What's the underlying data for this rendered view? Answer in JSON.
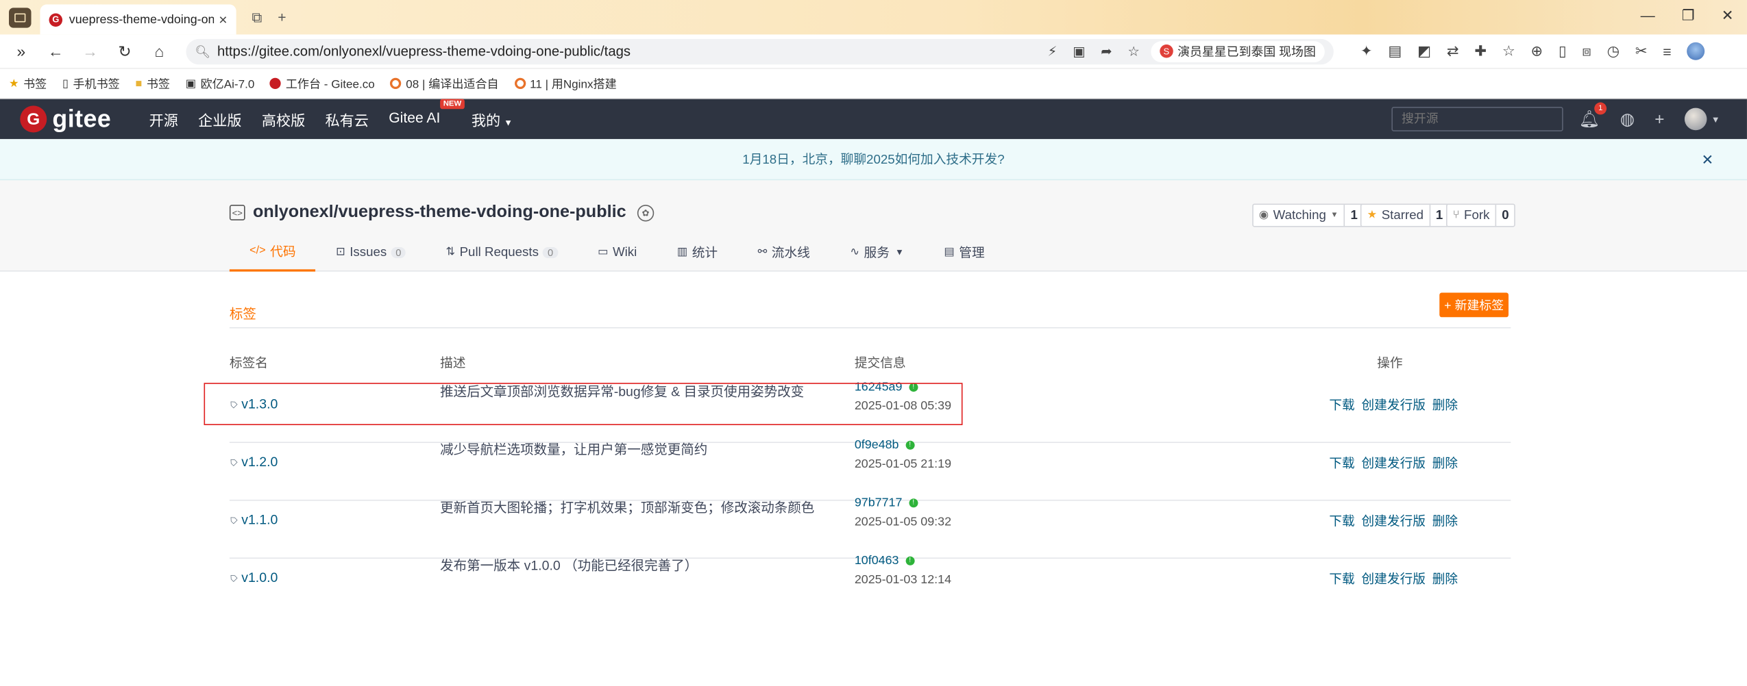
{
  "browser": {
    "tab_title": "vuepress-theme-vdoing-one-",
    "tab_close": "×",
    "new_tab": "+",
    "window_controls": [
      "—",
      "❐",
      "✕"
    ],
    "url": "https://gitee.com/onlyonexl/vuepress-theme-vdoing-one-public/tags",
    "hot_search": "演员星星已到泰国 现场图",
    "bookmarks": [
      {
        "label": "书签",
        "icon": "star-icon"
      },
      {
        "label": "手机书签",
        "icon": "phone-icon"
      },
      {
        "label": "书签",
        "icon": "folder-icon"
      },
      {
        "label": "欧亿Ai-7.0",
        "icon": "app-icon"
      },
      {
        "label": "工作台 - Gitee.co",
        "icon": "gitee-icon"
      },
      {
        "label": "08 | 编译出适合自",
        "icon": "orange-icon"
      },
      {
        "label": "11 | 用Nginx搭建",
        "icon": "orange-icon"
      }
    ]
  },
  "header": {
    "logo_text": "gitee",
    "nav": [
      "开源",
      "企业版",
      "高校版",
      "私有云",
      "Gitee AI",
      "我的"
    ],
    "new_badge": "NEW",
    "search_placeholder": "搜开源",
    "notification_count": "1"
  },
  "announcement": {
    "text": "1月18日，北京，聊聊2025如何加入技术开发?",
    "close": "✕"
  },
  "project": {
    "name": "onlyonexl/vuepress-theme-vdoing-one-public",
    "watch_label": "Watching",
    "watch_count": "1",
    "star_label": "Starred",
    "star_count": "1",
    "fork_label": "Fork",
    "fork_count": "0",
    "tabs": [
      {
        "label": "代码",
        "icon": "</>"
      },
      {
        "label": "Issues",
        "count": "0"
      },
      {
        "label": "Pull Requests",
        "count": "0"
      },
      {
        "label": "Wiki"
      },
      {
        "label": "统计"
      },
      {
        "label": "流水线"
      },
      {
        "label": "服务"
      },
      {
        "label": "管理"
      }
    ]
  },
  "tags_page": {
    "section_title": "标签",
    "new_tag_button": "+ 新建标签",
    "columns": [
      "标签名",
      "描述",
      "提交信息",
      "操作"
    ],
    "actions": [
      "下载",
      "创建发行版",
      "删除"
    ],
    "rows": [
      {
        "name": "v1.3.0",
        "description": "推送后文章顶部浏览数据异常-bug修复 & 目录页使用姿势改变",
        "sha": "16245a9",
        "date": "2025-01-08 05:39"
      },
      {
        "name": "v1.2.0",
        "description": "减少导航栏选项数量，让用户第一感觉更简约",
        "sha": "0f9e48b",
        "date": "2025-01-05 21:19"
      },
      {
        "name": "v1.1.0",
        "description": "更新首页大图轮播；打字机效果；顶部渐变色；修改滚动条颜色",
        "sha": "97b7717",
        "date": "2025-01-05 09:32"
      },
      {
        "name": "v1.0.0",
        "description": "发布第一版本 v1.0.0 （功能已经很完善了）",
        "sha": "10f0463",
        "date": "2025-01-03 12:14"
      }
    ]
  },
  "colors": {
    "accent": "#fe7300",
    "header_bg": "#2e3441",
    "link": "#005980",
    "highlight": "#e02020"
  }
}
